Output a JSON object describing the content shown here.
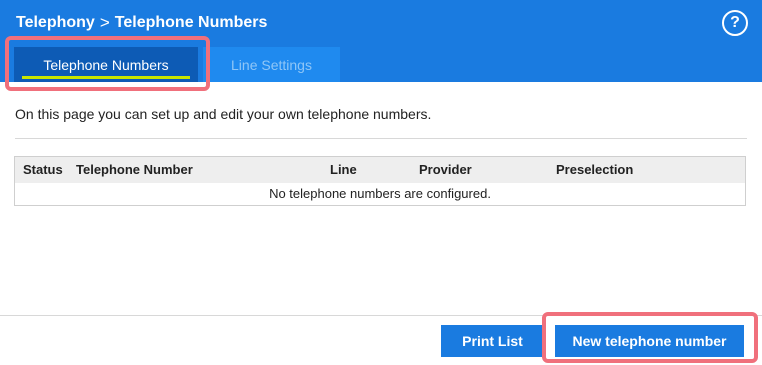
{
  "header": {
    "breadcrumb": [
      "Telephony",
      "Telephone Numbers"
    ],
    "separator": ">",
    "help_label": "?"
  },
  "tabs": [
    {
      "label": "Telephone Numbers",
      "active": true
    },
    {
      "label": "Line Settings",
      "active": false
    }
  ],
  "intro_text": "On this page you can set up and edit your own telephone numbers.",
  "table": {
    "columns": [
      "Status",
      "Telephone Number",
      "Line",
      "Provider",
      "Preselection"
    ],
    "empty_message": "No telephone numbers are configured."
  },
  "buttons": {
    "print_list": "Print List",
    "new_number": "New telephone number"
  },
  "colors": {
    "brand": "#1a7be0",
    "active_tab": "#0d5bb5",
    "accent_underline": "#c8e600",
    "highlight": "#f0707c"
  }
}
